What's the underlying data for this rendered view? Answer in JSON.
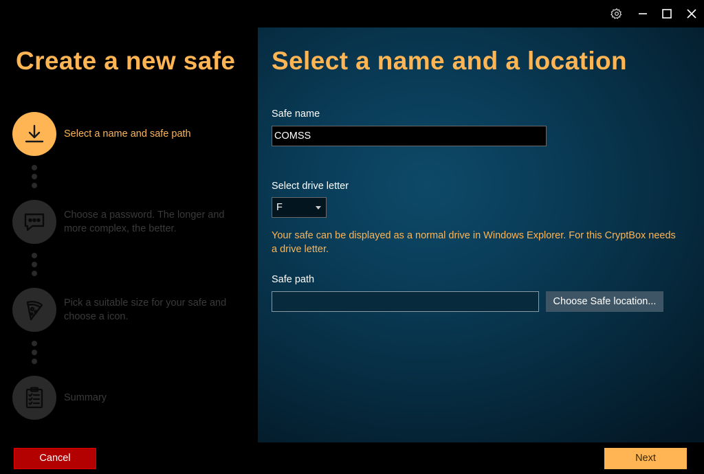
{
  "titlebar": {
    "icons": [
      "gear-icon",
      "minimize-icon",
      "maximize-icon",
      "close-icon"
    ]
  },
  "sidebar": {
    "title": "Create a new safe",
    "steps": [
      {
        "label": "Select a name and safe path",
        "icon": "download-icon",
        "state": "active"
      },
      {
        "label": "Choose a password. The longer and more complex, the better.",
        "icon": "chat-bubble-icon",
        "state": "inactive"
      },
      {
        "label": "Pick a suitable size for your safe and choose a icon.",
        "icon": "pizza-icon",
        "state": "inactive"
      },
      {
        "label": "Summary",
        "icon": "clipboard-checklist-icon",
        "state": "inactive"
      }
    ]
  },
  "main": {
    "title": "Select a name and a location",
    "safe_name": {
      "label": "Safe name",
      "value": "COMSS"
    },
    "drive_letter": {
      "label": "Select drive letter",
      "value": "F"
    },
    "hint": "Your safe can be displayed as a normal drive in Windows Explorer. For this CryptBox needs a drive letter.",
    "safe_path": {
      "label": "Safe path",
      "value": ""
    },
    "choose_location_label": "Choose Safe location..."
  },
  "footer": {
    "cancel_label": "Cancel",
    "next_label": "Next"
  },
  "colors": {
    "accent": "#ffb554",
    "cancel": "#b30000",
    "panel_bg": "#093a55"
  }
}
